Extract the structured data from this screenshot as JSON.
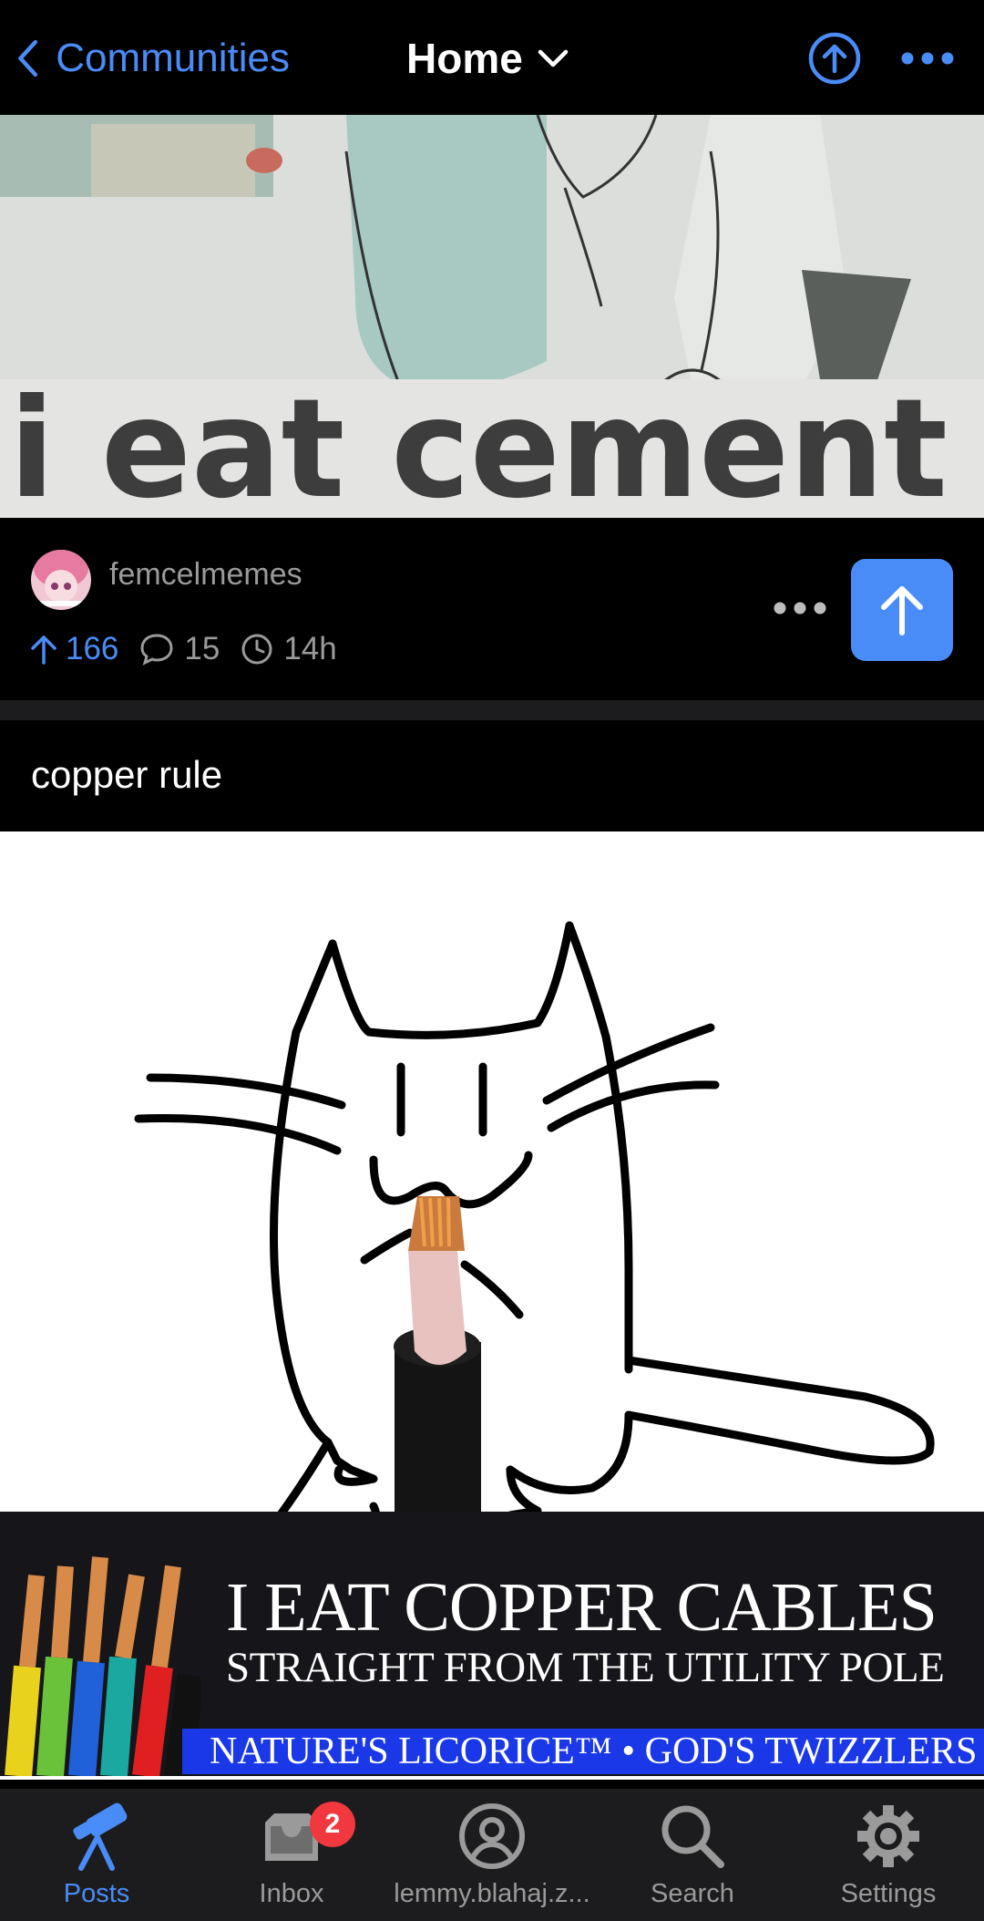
{
  "header": {
    "back_label": "Communities",
    "title": "Home"
  },
  "post1": {
    "image_caption": "i eat cement",
    "community": "femcelmemes",
    "score": "166",
    "comments": "15",
    "age": "14h"
  },
  "post2": {
    "title": "copper rule",
    "banner_line1": "I EAT COPPER CABLES",
    "banner_line2": "STRAIGHT FROM THE UTILITY POLE",
    "banner_line3": "NATURE'S LICORICE™ • GOD'S TWIZZLERS"
  },
  "nav": {
    "posts": "Posts",
    "inbox": "Inbox",
    "inbox_badge": "2",
    "instance": "lemmy.blahaj.z...",
    "search": "Search",
    "settings": "Settings"
  },
  "colors": {
    "accent": "#4a8cf7",
    "background": "#000000",
    "muted": "#9a9a9a",
    "badge": "#f0383e"
  },
  "icons": [
    "chevron-left-icon",
    "chevron-down-icon",
    "upload-circle-icon",
    "ellipsis-icon",
    "arrow-up-icon",
    "comment-icon",
    "clock-icon",
    "telescope-icon",
    "inbox-icon",
    "person-circle-icon",
    "search-icon",
    "gear-icon"
  ]
}
